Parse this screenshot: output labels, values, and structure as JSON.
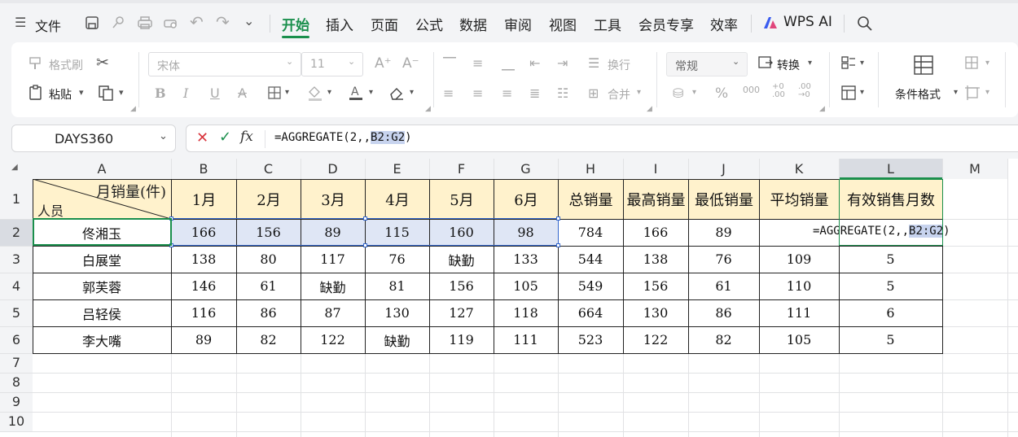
{
  "menu": {
    "file_label": "文件",
    "tabs": [
      "开始",
      "插入",
      "页面",
      "公式",
      "数据",
      "审阅",
      "视图",
      "工具",
      "会员专享",
      "效率"
    ],
    "active_tab": "开始",
    "ai_label": "WPS AI",
    "accent_color": "#1a8f4c"
  },
  "ribbon": {
    "format_painter": "格式刷",
    "paste": "粘贴",
    "font_name": "宋体",
    "font_size": "11",
    "wrap": "换行",
    "merge": "合并",
    "number_format": "常规",
    "convert": "转换",
    "conditional_format": "条件格式"
  },
  "formula_bar": {
    "name_box": "DAYS360",
    "formula_prefix": "=AGGREGATE(2,,",
    "formula_ref": "B2:G2",
    "formula_suffix": ")",
    "fx": "fx"
  },
  "sheet": {
    "columns": [
      "A",
      "B",
      "C",
      "D",
      "E",
      "F",
      "G",
      "H",
      "I",
      "J",
      "K",
      "L",
      "M"
    ],
    "rows": [
      "1",
      "2",
      "3",
      "4",
      "5",
      "6",
      "7",
      "8",
      "9",
      "10"
    ],
    "diag_top": "月销量(件)",
    "diag_bottom": "人员",
    "headers": [
      "1月",
      "2月",
      "3月",
      "4月",
      "5月",
      "6月",
      "总销量",
      "最高销量",
      "最低销量",
      "平均销量",
      "有效销售月数"
    ],
    "data": [
      [
        "佟湘玉",
        "166",
        "156",
        "89",
        "115",
        "160",
        "98",
        "784",
        "166",
        "89",
        "",
        ""
      ],
      [
        "白展堂",
        "138",
        "80",
        "117",
        "76",
        "缺勤",
        "133",
        "544",
        "138",
        "76",
        "109",
        "5"
      ],
      [
        "郭芙蓉",
        "146",
        "61",
        "缺勤",
        "81",
        "156",
        "105",
        "549",
        "156",
        "61",
        "110",
        "5"
      ],
      [
        "吕轻侯",
        "116",
        "86",
        "87",
        "130",
        "127",
        "118",
        "664",
        "130",
        "86",
        "111",
        "6"
      ],
      [
        "李大嘴",
        "89",
        "82",
        "122",
        "缺勤",
        "119",
        "111",
        "523",
        "122",
        "82",
        "105",
        "5"
      ]
    ],
    "edit_cell": {
      "prefix": "=AGGREGATE(2,,",
      "ref": "B2:G2",
      "suffix": ")"
    },
    "header_fill": "#fff2cc",
    "selection_fill": "#dfe6f5"
  }
}
